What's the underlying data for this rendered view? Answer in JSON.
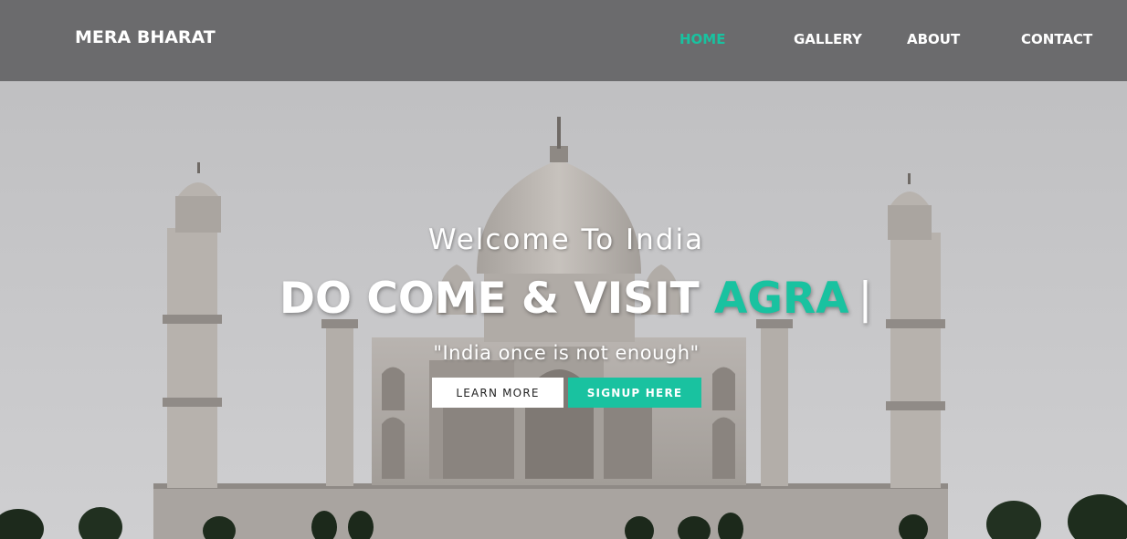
{
  "nav": {
    "brand": "MERA BHARAT",
    "links": [
      {
        "label": "HOME",
        "active": true
      },
      {
        "label": "GALLERY",
        "active": false
      },
      {
        "label": "ABOUT",
        "active": false
      },
      {
        "label": "CONTACT",
        "active": false
      }
    ]
  },
  "hero": {
    "welcome": "Welcome To India",
    "headline_prefix": "DO COME & VISIT ",
    "headline_accent": "AGRA",
    "headline_cursor": "|",
    "tagline": "\"India once is not enough\"",
    "buttons": {
      "learn_more": "LEARN MORE",
      "signup": "SIGNUP HERE"
    }
  },
  "colors": {
    "accent": "#19c2a0",
    "navbar": "#626264",
    "sky": "#c9c9cb"
  },
  "background_image": "taj-mahal-photo"
}
